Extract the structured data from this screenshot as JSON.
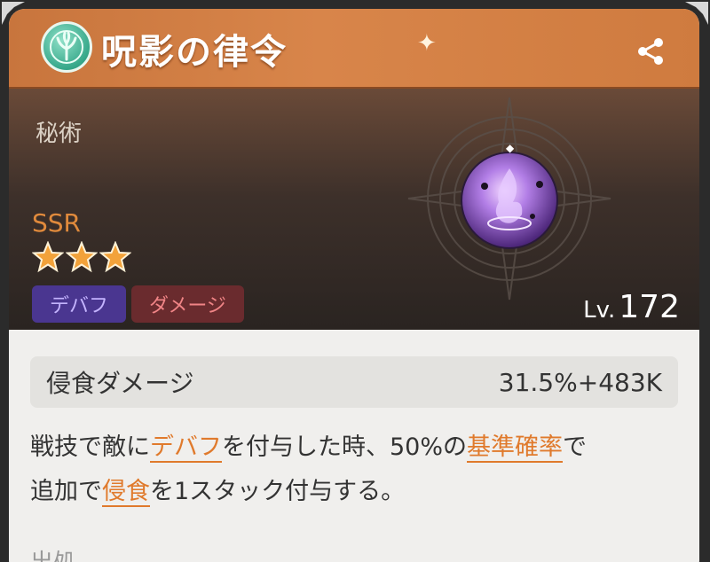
{
  "header": {
    "title": "呪影の律令"
  },
  "hero": {
    "category": "秘術",
    "rarity": "SSR",
    "stars": 3,
    "tags": [
      "デバフ",
      "ダメージ"
    ],
    "level_prefix": "Lv.",
    "level_value": "172"
  },
  "stat": {
    "label": "侵食ダメージ",
    "value": "31.5%+483K"
  },
  "description": {
    "p1": "戦技で敵に",
    "h1": "デバフ",
    "p2": "を付与した時、50%の",
    "h2": "基準確率",
    "p3": "で",
    "p4": "追加で",
    "h3": "侵食",
    "p5": "を1スタック付与する。"
  },
  "source": {
    "label": "出処"
  },
  "colors": {
    "title_bar": "#d8854a",
    "highlight": "#e07a2c",
    "rarity": "#e08a3c",
    "tag_debuff": "#4a3690",
    "tag_damage": "#6a2b2e"
  },
  "icons": {
    "emblem": "tree-emblem-icon",
    "share": "share-icon",
    "star": "star-icon",
    "orb": "purple-flame-orb-icon"
  }
}
